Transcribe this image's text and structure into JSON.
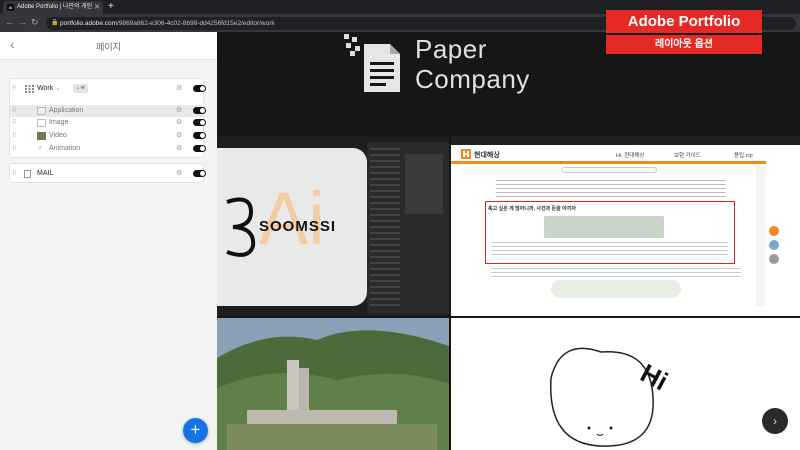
{
  "browser": {
    "tab_title": "Adobe Portfolio | 나만의 개인",
    "tab_favicon": "Ai",
    "url_host": "portfolio.adobe.com",
    "url_path": "/9869a862-e306-4c02-8b98-dd4256fd15e2/editor/work"
  },
  "sidebar": {
    "title": "페이지",
    "pages": [
      {
        "label": "Work",
        "badge": "⌂ ≣",
        "type": "gallery"
      },
      {
        "label": "Application",
        "type": "page"
      },
      {
        "label": "Image",
        "type": "page"
      },
      {
        "label": "Video",
        "type": "page"
      },
      {
        "label": "Animation",
        "type": "page"
      },
      {
        "label": "MAIL",
        "type": "page"
      }
    ]
  },
  "main": {
    "logo_line1": "Paper",
    "logo_line2": "Company",
    "tile_ai_brand": "SOOMSSI",
    "tile_ai_mark": "Ai",
    "tile_web_site": "현대해상",
    "tile_web_nav": [
      "Hi, 현대해상",
      "보험 가이드",
      "용팁.zip"
    ],
    "tile_web_headline": "혹고 싶은 게 많아니까, 사건과 돈을 아끼자",
    "tile_doodle_text": "Hi"
  },
  "overlay": {
    "title": "Adobe Portfolio",
    "subtitle": "레이아웃 옵션"
  },
  "colors": {
    "accent": "#1473e6",
    "overlay_red": "#e52a25",
    "brand_orange": "#f08a1c"
  }
}
